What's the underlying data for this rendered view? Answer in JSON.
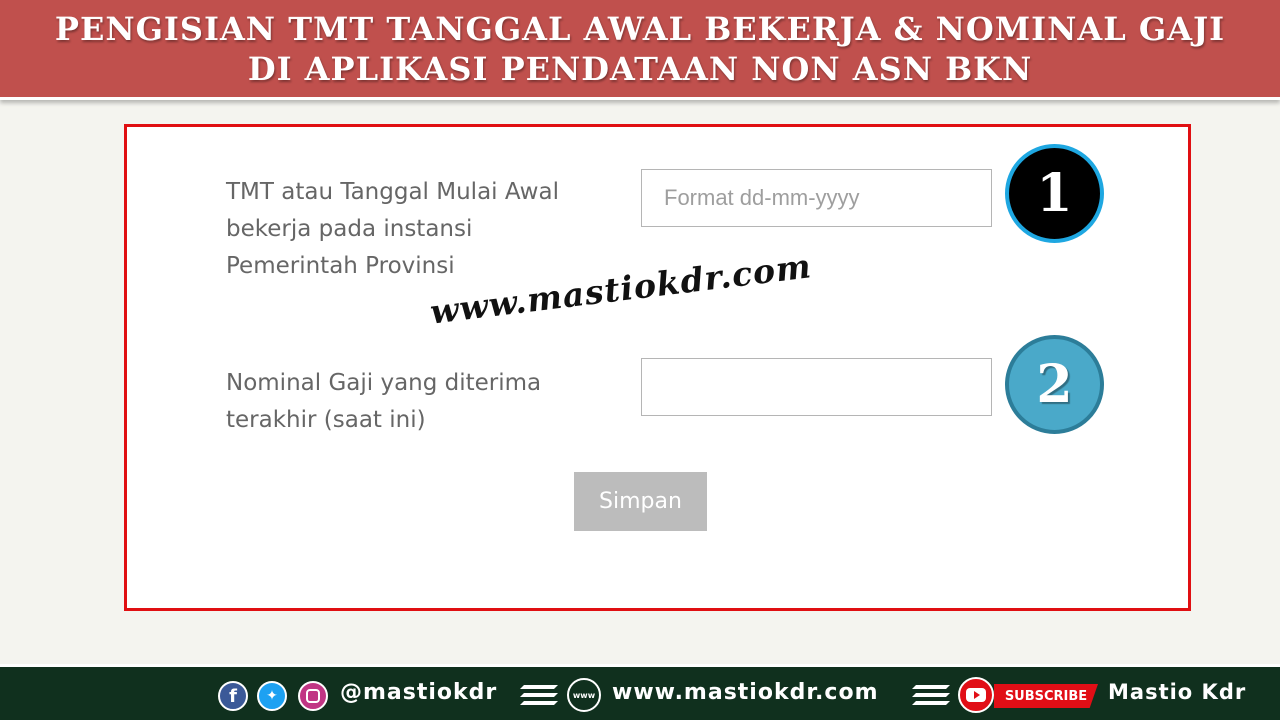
{
  "header": {
    "title_line1": "PENGISIAN TMT TANGGAL AWAL BEKERJA & NOMINAL GAJI",
    "title_line2": "DI APLIKASI PENDATAAN NON ASN BKN"
  },
  "form": {
    "tmt_label": "TMT atau Tanggal Mulai Awal bekerja pada instansi Pemerintah Provinsi",
    "tmt_placeholder": "Format dd-mm-yyyy",
    "tmt_value": "",
    "gaji_label": "Nominal Gaji yang diterima terakhir (saat ini)",
    "gaji_value": "",
    "submit_label": "Simpan"
  },
  "badges": {
    "step1": "1",
    "step2": "2"
  },
  "watermark": "www.mastiokdr.com",
  "footer": {
    "social_handle": "@mastiokdr",
    "website": "www.mastiokdr.com",
    "globe_text": "www",
    "subscribe_label": "SUBSCRIBE",
    "channel_name": "Mastio Kdr",
    "icons": [
      "facebook-icon",
      "twitter-icon",
      "instagram-icon",
      "globe-icon",
      "youtube-icon"
    ]
  },
  "colors": {
    "banner": "#c0504d",
    "panel_border": "#e00f12",
    "badge1_fill": "#000000",
    "badge2_fill": "#4aa9c9",
    "button": "#bcbcbc",
    "footer": "#10301e"
  }
}
